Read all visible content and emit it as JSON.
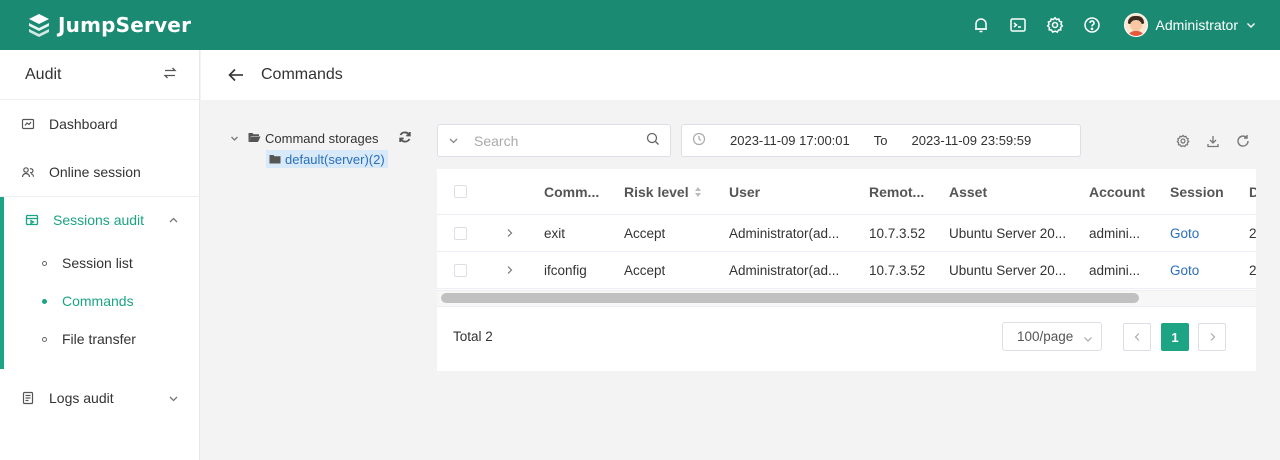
{
  "app": {
    "name": "JumpServer",
    "brand_color": "#1b8a72",
    "accent_color": "#1ca485"
  },
  "topbar": {
    "icons": [
      "bell-icon",
      "terminal-icon",
      "gear-icon",
      "help-icon"
    ],
    "user": {
      "name": "Administrator"
    }
  },
  "sidebar": {
    "title": "Audit",
    "items": [
      {
        "label": "Dashboard",
        "icon": "dashboard-icon"
      },
      {
        "label": "Online session",
        "icon": "users-icon"
      },
      {
        "label": "Sessions audit",
        "icon": "video-icon",
        "expanded": true,
        "children": [
          {
            "label": "Session list"
          },
          {
            "label": "Commands",
            "active": true
          },
          {
            "label": "File transfer"
          }
        ]
      },
      {
        "label": "Logs audit",
        "icon": "log-icon",
        "expanded": false
      }
    ]
  },
  "page": {
    "title": "Commands"
  },
  "tree": {
    "root": "Command storages",
    "child": "default(server)(2)"
  },
  "filters": {
    "search_placeholder": "Search",
    "date_from": "2023-11-09 17:00:01",
    "to_label": "To",
    "date_to": "2023-11-09 23:59:59"
  },
  "table": {
    "columns": [
      "Comm...",
      "Risk level",
      "User",
      "Remot...",
      "Asset",
      "Account",
      "Session",
      "D"
    ],
    "rows": [
      {
        "command": "exit",
        "risk": "Accept",
        "user": "Administrator(ad...",
        "remote": "10.7.3.52",
        "asset": "Ubuntu Server 20...",
        "account": "admini...",
        "session": "Goto",
        "extra": "2"
      },
      {
        "command": "ifconfig",
        "risk": "Accept",
        "user": "Administrator(ad...",
        "remote": "10.7.3.52",
        "asset": "Ubuntu Server 20...",
        "account": "admini...",
        "session": "Goto",
        "extra": "2"
      }
    ]
  },
  "pagination": {
    "total": "Total 2",
    "page_size": "100/page",
    "current": "1"
  }
}
